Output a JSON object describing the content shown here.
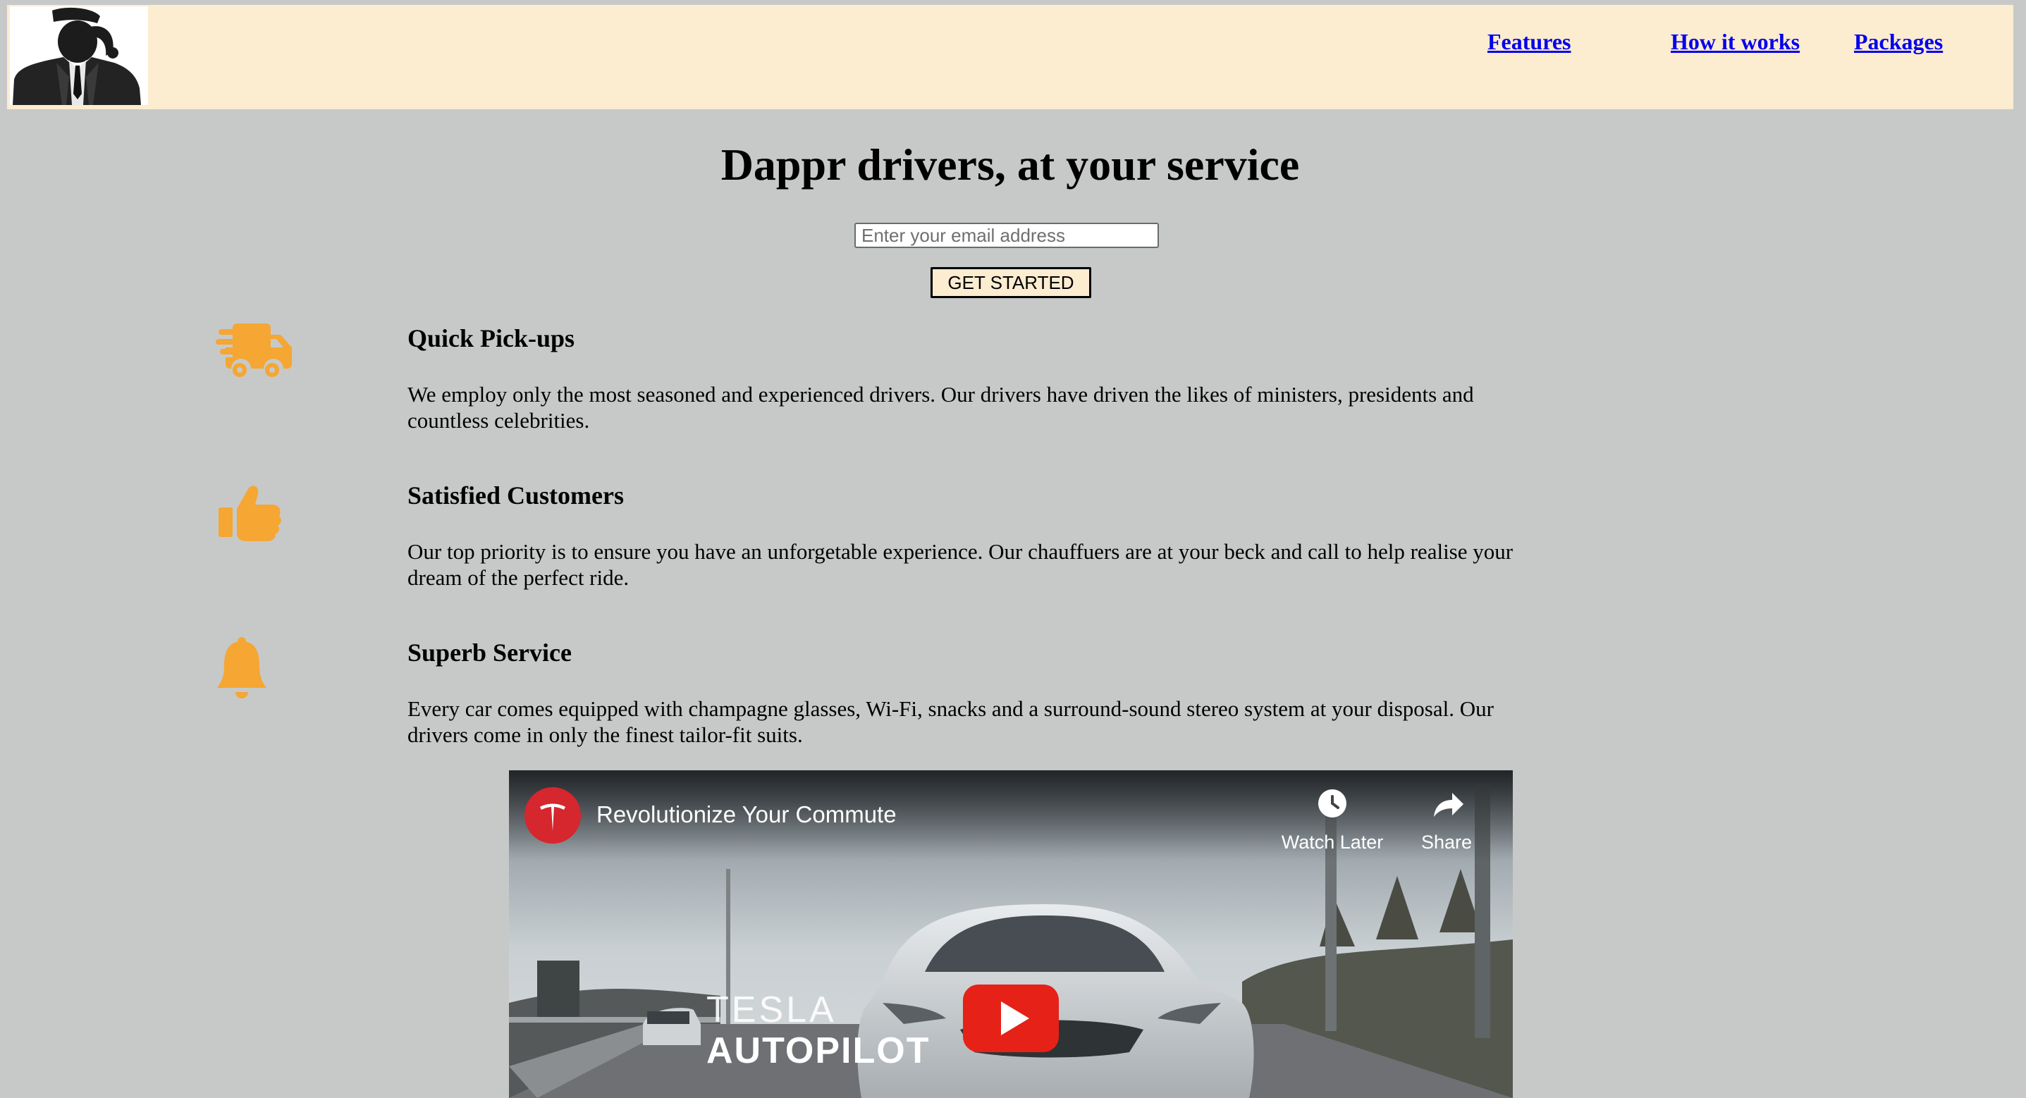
{
  "header": {
    "nav": {
      "features": "Features",
      "how_it_works": "How it works",
      "packages": "Packages"
    }
  },
  "hero": {
    "title": "Dappr drivers, at your service",
    "email_placeholder": "Enter your email address",
    "cta_label": "GET STARTED"
  },
  "features": [
    {
      "icon": "shipping-fast-icon",
      "title": "Quick Pick-ups",
      "text": "We employ only the most seasoned and experienced drivers. Our drivers have driven the likes of ministers, presidents and countless celebrities."
    },
    {
      "icon": "thumbs-up-icon",
      "title": "Satisfied Customers",
      "text": "Our top priority is to ensure you have an unforgetable experience. Our chauffuers are at your beck and call to help realise your dream of the perfect ride."
    },
    {
      "icon": "bell-icon",
      "title": "Superb Service",
      "text": "Every car comes equipped with champagne glasses, Wi-Fi, snacks and a surround-sound stereo system at your disposal. Our drivers come in only the finest tailor-fit suits."
    }
  ],
  "video": {
    "title": "Revolutionize Your Commute",
    "watch_later_label": "Watch Later",
    "share_label": "Share",
    "overlay_line1": "TESLA",
    "overlay_line2": "AUTOPILOT"
  },
  "colors": {
    "page_background": "#c7c9c8",
    "header_background": "#fcecd0",
    "icon_accent": "#f5a633",
    "link": "#0000ee",
    "youtube_red": "#e62117",
    "tesla_red": "#d6262e"
  }
}
